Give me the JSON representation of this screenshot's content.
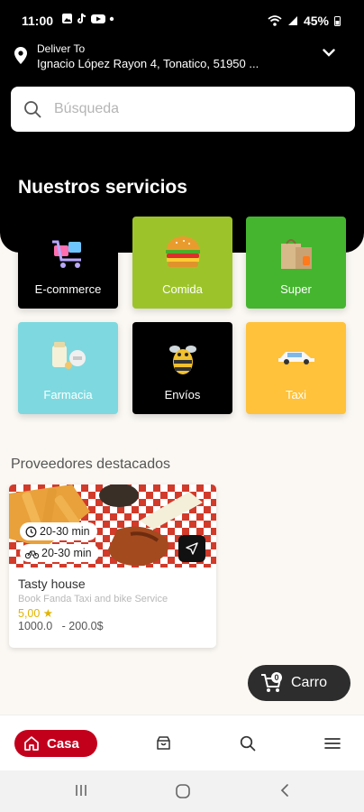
{
  "status_bar": {
    "time": "11:00",
    "battery": "45%"
  },
  "deliver": {
    "label": "Deliver To",
    "address": "Ignacio López Rayon 4, Tonatico, 51950 ..."
  },
  "search": {
    "placeholder": "Búsqueda"
  },
  "services": {
    "title": "Nuestros servicios",
    "items": [
      {
        "label": "E-commerce",
        "icon": "shopping-cart-icon",
        "color": "#000000"
      },
      {
        "label": "Comida",
        "icon": "burger-icon",
        "color": "#9cc42a"
      },
      {
        "label": "Super",
        "icon": "grocery-bag-icon",
        "color": "#45b52f"
      },
      {
        "label": "Farmacia",
        "icon": "pills-icon",
        "color": "#7dd9df"
      },
      {
        "label": "Envíos",
        "icon": "delivery-bee-icon",
        "color": "#000000"
      },
      {
        "label": "Taxi",
        "icon": "car-icon",
        "color": "#ffc23a"
      }
    ]
  },
  "featured": {
    "title": "Proveedores destacados",
    "providers": [
      {
        "time_1": "20-30 min",
        "time_2": "20-30 min",
        "name": "Tasty house",
        "subtitle": "Book Fanda Taxi and bike Service",
        "rating": "5,00 ★",
        "price": "1000.0   - 200.0$"
      }
    ]
  },
  "cart": {
    "label": "Carro",
    "count": "0"
  },
  "bottom_nav": {
    "home_label": "Casa"
  },
  "colors": {
    "accent": "#c3001c",
    "header": "#000000",
    "star": "#e0b400"
  }
}
